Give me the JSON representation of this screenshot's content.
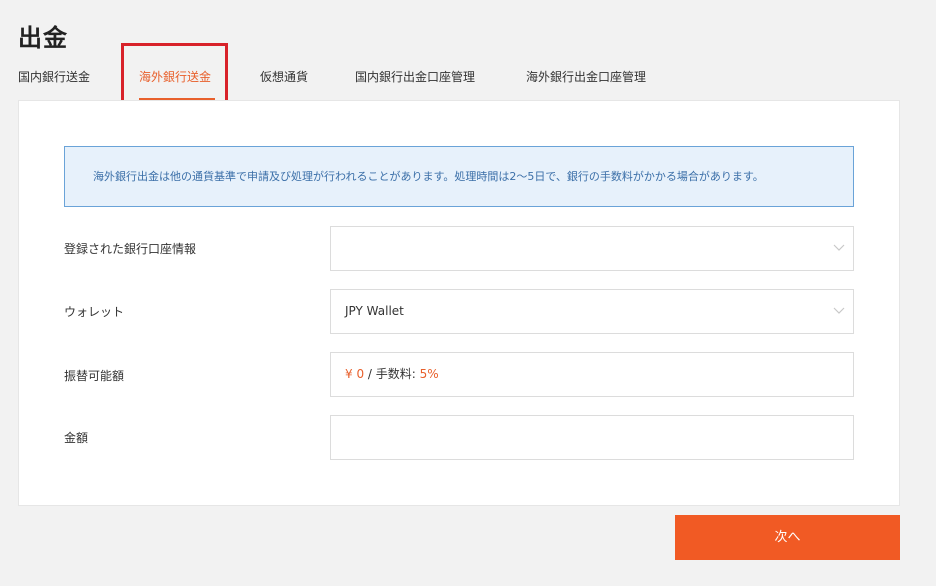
{
  "page": {
    "title": "出金"
  },
  "tabs": [
    {
      "label": "国内銀行送金"
    },
    {
      "label": "海外銀行送金",
      "active": true
    },
    {
      "label": "仮想通貨"
    },
    {
      "label": "国内銀行出金口座管理"
    },
    {
      "label": "海外銀行出金口座管理"
    }
  ],
  "notice": {
    "text": "海外銀行出金は他の通貨基準で申請及び処理が行われることがあります。処理時間は2〜5日で、銀行の手数料がかかる場合があります。"
  },
  "form": {
    "bank_account": {
      "label": "登録された銀行口座情報",
      "value": ""
    },
    "wallet": {
      "label": "ウォレット",
      "value": "JPY Wallet"
    },
    "available": {
      "label": "振替可能額",
      "amount": "¥ 0",
      "separator": "/",
      "fee_label": "手数料:",
      "fee_value": "5%"
    },
    "amount": {
      "label": "金額",
      "value": ""
    }
  },
  "actions": {
    "next_label": "次へ"
  },
  "colors": {
    "accent": "#e8602c",
    "button": "#f15a24",
    "notice_bg": "#e7f1fb",
    "notice_border": "#6aa3d8",
    "highlight": "#d8222a"
  }
}
